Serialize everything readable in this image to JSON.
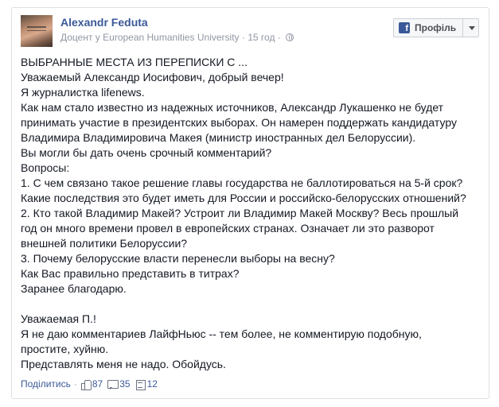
{
  "post": {
    "author": "Alexandr Feduta",
    "subtitle_prefix": "Доцент у ",
    "organization": "European Humanities University",
    "time": "15 год",
    "visibility_icon": "globe-icon"
  },
  "profile_button": {
    "icon": "facebook-icon",
    "label": "Профіль"
  },
  "body": {
    "paragraph1": [
      "ВЫБРАННЫЕ МЕСТА ИЗ ПЕРЕПИСКИ С ...",
      "Уважаемый Александр Иосифович, добрый вечер!",
      "Я журналистка lifenews.",
      "Как нам стало известно из надежных источников, Александр Лукашенко не будет",
      "принимать участие в президентских выборах. Он намерен поддержать кандидатуру",
      "Владимира Владимировича Макея (министр иностранных дел Белоруссии).",
      "Вы могли бы дать очень срочный комментарий?",
      "Вопросы:",
      "1. С чем связано такое решение главы государства не баллотироваться на 5-й срок?",
      "Какие последствия это будет иметь для России и российско-белорусских отношений?",
      "2. Кто такой Владимир Макей? Устроит ли Владимир Макей Москву? Весь прошлый",
      "год он много времени провел в европейских странах. Означает ли это разворот",
      "внешней политики Белоруссии?",
      "3. Почему белорусские власти перенесли выборы на весну?",
      "Как Вас правильно представить в титрах?",
      "Заранее благодарю."
    ],
    "paragraph2": [
      "Уважаемая П.!",
      "Я не даю комментариев ЛайфНьюс -- тем более, не комментирую подобную,",
      "простите, хуйню.",
      "Представлять меня не надо. Обойдусь."
    ]
  },
  "footer": {
    "share_label": "Поділитись",
    "separator": "·",
    "likes": "87",
    "comments": "35",
    "shares": "12"
  }
}
